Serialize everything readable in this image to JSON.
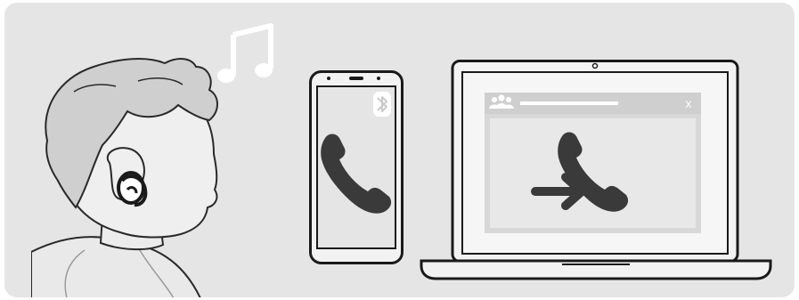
{
  "music": {
    "icon": "music-note-icon"
  },
  "phone": {
    "status_icon": "bluetooth-icon",
    "call_icon": "phone-handset-icon"
  },
  "laptop": {
    "app_window": {
      "title_icon": "group-users-icon",
      "close_label": "x",
      "content_icons": [
        "arrow-right-icon",
        "phone-handset-icon"
      ]
    }
  },
  "colors": {
    "background": "#e5e5e5",
    "outline": "#1a1a1a",
    "dark_icon": "#3a3a3a",
    "panel": "#d8d8d8",
    "titlebar": "#cfcfcf"
  }
}
